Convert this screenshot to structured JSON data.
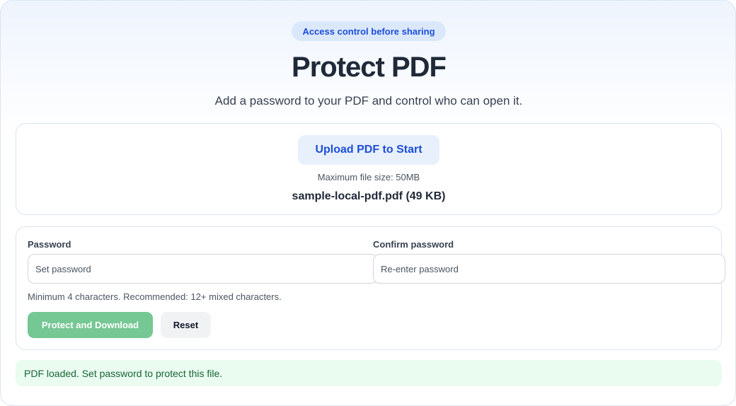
{
  "header": {
    "badge": "Access control before sharing",
    "title": "Protect PDF",
    "subtitle": "Add a password to your PDF and control who can open it."
  },
  "upload": {
    "button_label": "Upload PDF to Start",
    "max_size": "Maximum file size: 50MB",
    "file_name": "sample-local-pdf.pdf (49 KB)"
  },
  "form": {
    "password_label": "Password",
    "password_placeholder": "Set password",
    "password_value": "",
    "confirm_label": "Confirm password",
    "confirm_placeholder": "Re-enter password",
    "confirm_value": "",
    "hint": "Minimum 4 characters. Recommended: 12+ mixed characters.",
    "protect_label": "Protect and Download",
    "reset_label": "Reset"
  },
  "status": {
    "message": "PDF loaded. Set password to protect this file."
  },
  "colors": {
    "accent": "#1d4ed8",
    "primary_button": "#75c794",
    "status_bg": "#eafbf0",
    "status_text": "#166534"
  }
}
